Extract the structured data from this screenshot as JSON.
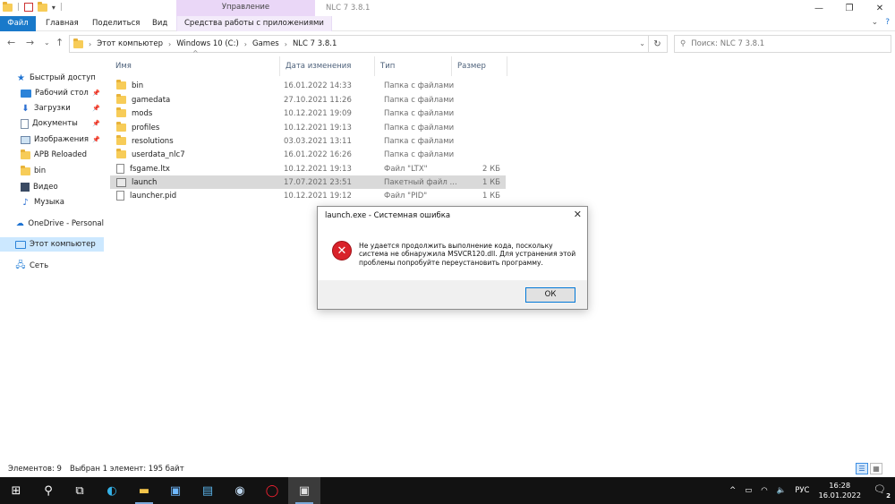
{
  "window": {
    "title": "NLC 7 3.8.1",
    "context_tab": "Управление"
  },
  "ribbon": {
    "tabs": [
      "Файл",
      "Главная",
      "Поделиться",
      "Вид",
      "Средства работы с приложениями"
    ]
  },
  "address": {
    "crumbs": [
      "Этот компьютер",
      "Windows 10 (C:)",
      "Games",
      "NLC 7 3.8.1"
    ],
    "search_placeholder": "Поиск: NLC 7 3.8.1"
  },
  "nav": {
    "quick_access": "Быстрый доступ",
    "items": [
      "Рабочий стол",
      "Загрузки",
      "Документы",
      "Изображения",
      "APB Reloaded",
      "bin",
      "Видео",
      "Музыка"
    ],
    "onedrive": "OneDrive - Personal",
    "this_pc": "Этот компьютер",
    "network": "Сеть"
  },
  "columns": {
    "name": "Имя",
    "date": "Дата изменения",
    "type": "Тип",
    "size": "Размер"
  },
  "files": [
    {
      "name": "bin",
      "date": "16.01.2022 14:33",
      "type": "Папка с файлами",
      "size": ""
    },
    {
      "name": "gamedata",
      "date": "27.10.2021 11:26",
      "type": "Папка с файлами",
      "size": ""
    },
    {
      "name": "mods",
      "date": "10.12.2021 19:09",
      "type": "Папка с файлами",
      "size": ""
    },
    {
      "name": "profiles",
      "date": "10.12.2021 19:13",
      "type": "Папка с файлами",
      "size": ""
    },
    {
      "name": "resolutions",
      "date": "03.03.2021 13:11",
      "type": "Папка с файлами",
      "size": ""
    },
    {
      "name": "userdata_nlc7",
      "date": "16.01.2022 16:26",
      "type": "Папка с файлами",
      "size": ""
    },
    {
      "name": "fsgame.ltx",
      "date": "10.12.2021 19:13",
      "type": "Файл \"LTX\"",
      "size": "2 КБ"
    },
    {
      "name": "launch",
      "date": "17.07.2021 23:51",
      "type": "Пакетный файл ...",
      "size": "1 КБ"
    },
    {
      "name": "launcher.pid",
      "date": "10.12.2021 19:12",
      "type": "Файл \"PID\"",
      "size": "1 КБ"
    }
  ],
  "dialog": {
    "title": "launch.exe - Системная ошибка",
    "message": "Не удается продолжить выполнение кода, поскольку система не обнаружила MSVCR120.dll. Для устранения этой проблемы попробуйте переустановить программу.",
    "ok": "ОК"
  },
  "status": {
    "count": "Элементов: 9",
    "selected": "Выбран 1 элемент: 195 байт"
  },
  "taskbar": {
    "lang": "РУС",
    "time": "16:28",
    "date": "16.01.2022",
    "notifications": "2"
  }
}
